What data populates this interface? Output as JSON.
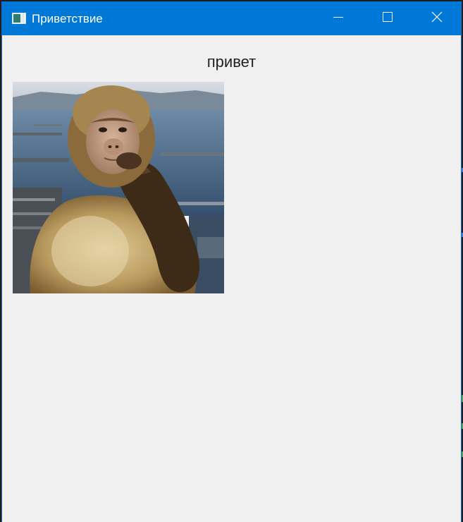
{
  "window": {
    "title": "Приветствие",
    "icon": "window-app-icon",
    "controls": {
      "minimize_icon": "minimize-icon",
      "maximize_icon": "maximize-icon",
      "close_icon": "close-icon"
    },
    "accent_color": "#0078d7",
    "background_color": "#f0f0f0"
  },
  "content": {
    "greeting": "привет",
    "image_description_icon": "monkey-photo"
  }
}
